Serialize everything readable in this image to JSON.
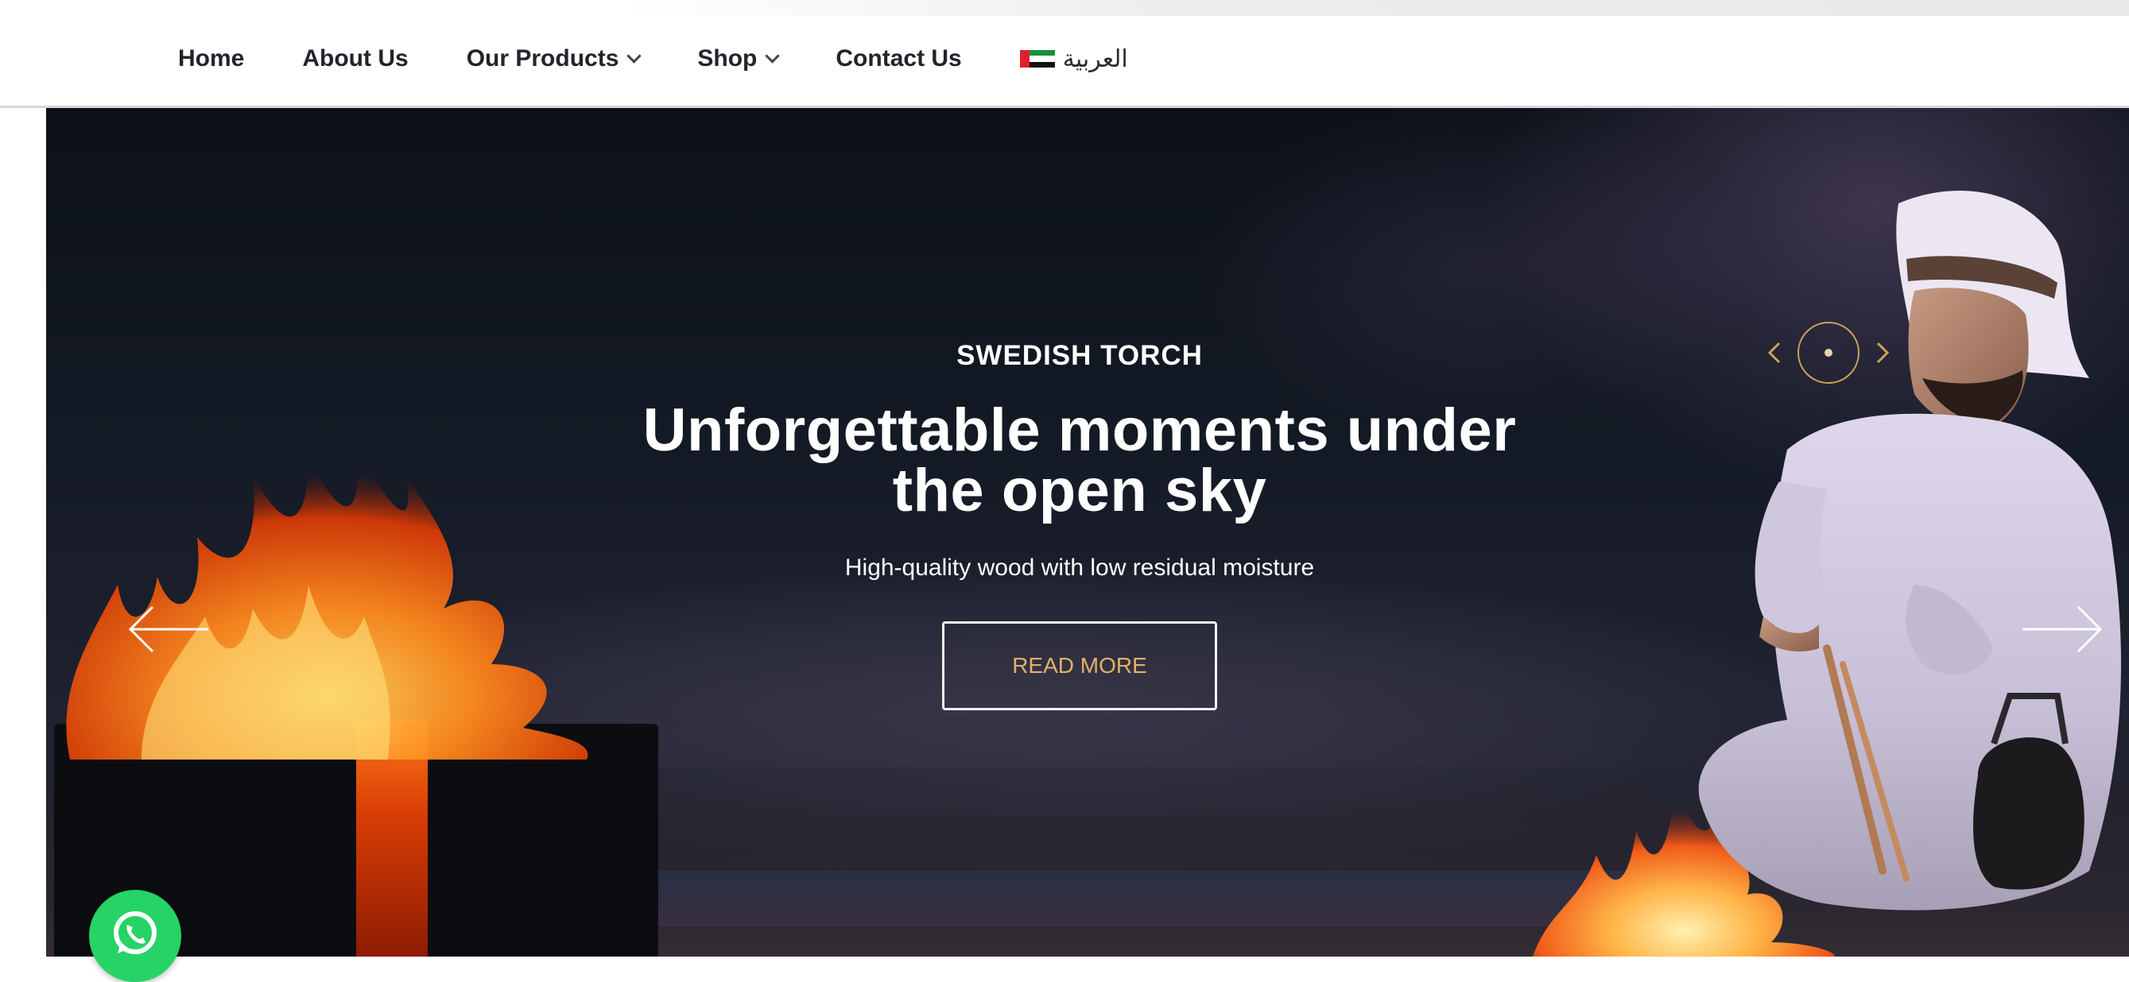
{
  "nav": {
    "items": [
      {
        "label": "Home",
        "dropdown": false
      },
      {
        "label": "About Us",
        "dropdown": false
      },
      {
        "label": "Our Products",
        "dropdown": true
      },
      {
        "label": "Shop",
        "dropdown": true
      },
      {
        "label": "Contact Us",
        "dropdown": false
      }
    ],
    "language": {
      "label": "العربية",
      "flag": "uae-flag-icon"
    }
  },
  "hero": {
    "kicker": "SWEDISH TORCH",
    "headline_line1": "Unforgettable moments under",
    "headline_line2": "the open sky",
    "subline": "High-quality wood with low residual moisture",
    "cta_label": "READ MORE",
    "prev_icon": "arrow-left-icon",
    "next_icon": "arrow-right-icon",
    "indicator_icon": "slide-indicator-icon"
  },
  "colors": {
    "cta_text": "#e4b06a",
    "indicator_gold": "#c9a45c",
    "whatsapp_green": "#25d366",
    "nav_text": "#23232b"
  },
  "whatsapp": {
    "icon": "whatsapp-icon"
  }
}
